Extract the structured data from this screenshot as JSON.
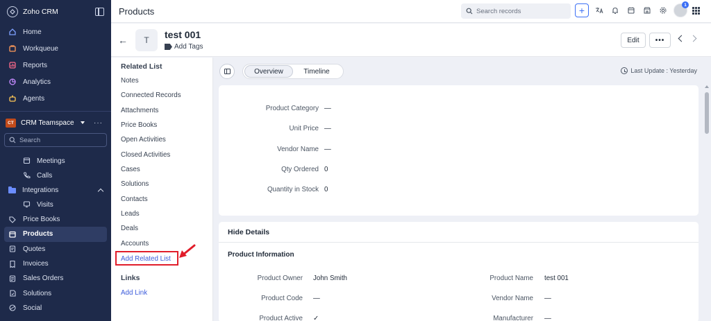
{
  "sidebar": {
    "brand": "Zoho CRM",
    "nav": [
      {
        "label": "Home",
        "icon": "home-icon"
      },
      {
        "label": "Workqueue",
        "icon": "workqueue-icon"
      },
      {
        "label": "Reports",
        "icon": "reports-icon"
      },
      {
        "label": "Analytics",
        "icon": "analytics-icon"
      },
      {
        "label": "Agents",
        "icon": "agents-icon"
      }
    ],
    "teamspace": {
      "badge": "CT",
      "name": "CRM Teamspace",
      "more": "···"
    },
    "search_placeholder": "Search",
    "sub_items_top": [
      {
        "label": "Meetings",
        "icon": "calendar-icon"
      },
      {
        "label": "Calls",
        "icon": "phone-icon"
      }
    ],
    "integrations": "Integrations",
    "visits": "Visits",
    "modules": [
      {
        "label": "Price Books",
        "icon": "tag-icon"
      },
      {
        "label": "Products",
        "icon": "box-icon",
        "active": true
      },
      {
        "label": "Quotes",
        "icon": "quote-icon"
      },
      {
        "label": "Invoices",
        "icon": "invoice-icon"
      },
      {
        "label": "Sales Orders",
        "icon": "sales-order-icon"
      },
      {
        "label": "Solutions",
        "icon": "solutions-icon"
      },
      {
        "label": "Social",
        "icon": "social-icon"
      }
    ]
  },
  "topbar": {
    "title": "Products",
    "search_placeholder": "Search records",
    "plus": "+",
    "avatar_badge": "1"
  },
  "record": {
    "initial": "T",
    "title": "test 001",
    "add_tags": "Add Tags",
    "edit": "Edit",
    "more": "•••"
  },
  "related": {
    "heading": "Related List",
    "items": [
      "Notes",
      "Connected Records",
      "Attachments",
      "Price Books",
      "Open Activities",
      "Closed Activities",
      "Cases",
      "Solutions",
      "Contacts",
      "Leads",
      "Deals",
      "Accounts"
    ],
    "add_related": "Add Related List",
    "links_heading": "Links",
    "add_link": "Add Link"
  },
  "tabs": {
    "overview": "Overview",
    "timeline": "Timeline",
    "last_update": "Last Update : Yesterday"
  },
  "overview_fields": [
    {
      "label": "Product Category",
      "value": "—"
    },
    {
      "label": "Unit Price",
      "value": "—"
    },
    {
      "label": "Vendor Name",
      "value": "—"
    },
    {
      "label": "Qty Ordered",
      "value": "0"
    },
    {
      "label": "Quantity in Stock",
      "value": "0"
    }
  ],
  "details": {
    "hide": "Hide Details",
    "section": "Product Information",
    "left": [
      {
        "label": "Product Owner",
        "value": "John Smith"
      },
      {
        "label": "Product Code",
        "value": "—"
      },
      {
        "label": "Product Active",
        "value": "✓"
      }
    ],
    "right": [
      {
        "label": "Product Name",
        "value": "test 001"
      },
      {
        "label": "Vendor Name",
        "value": "—"
      },
      {
        "label": "Manufacturer",
        "value": "—"
      }
    ]
  },
  "colors": {
    "sidebar": "#1e2a4a",
    "accent": "#3b6ff5",
    "highlight": "#e11d2a"
  }
}
